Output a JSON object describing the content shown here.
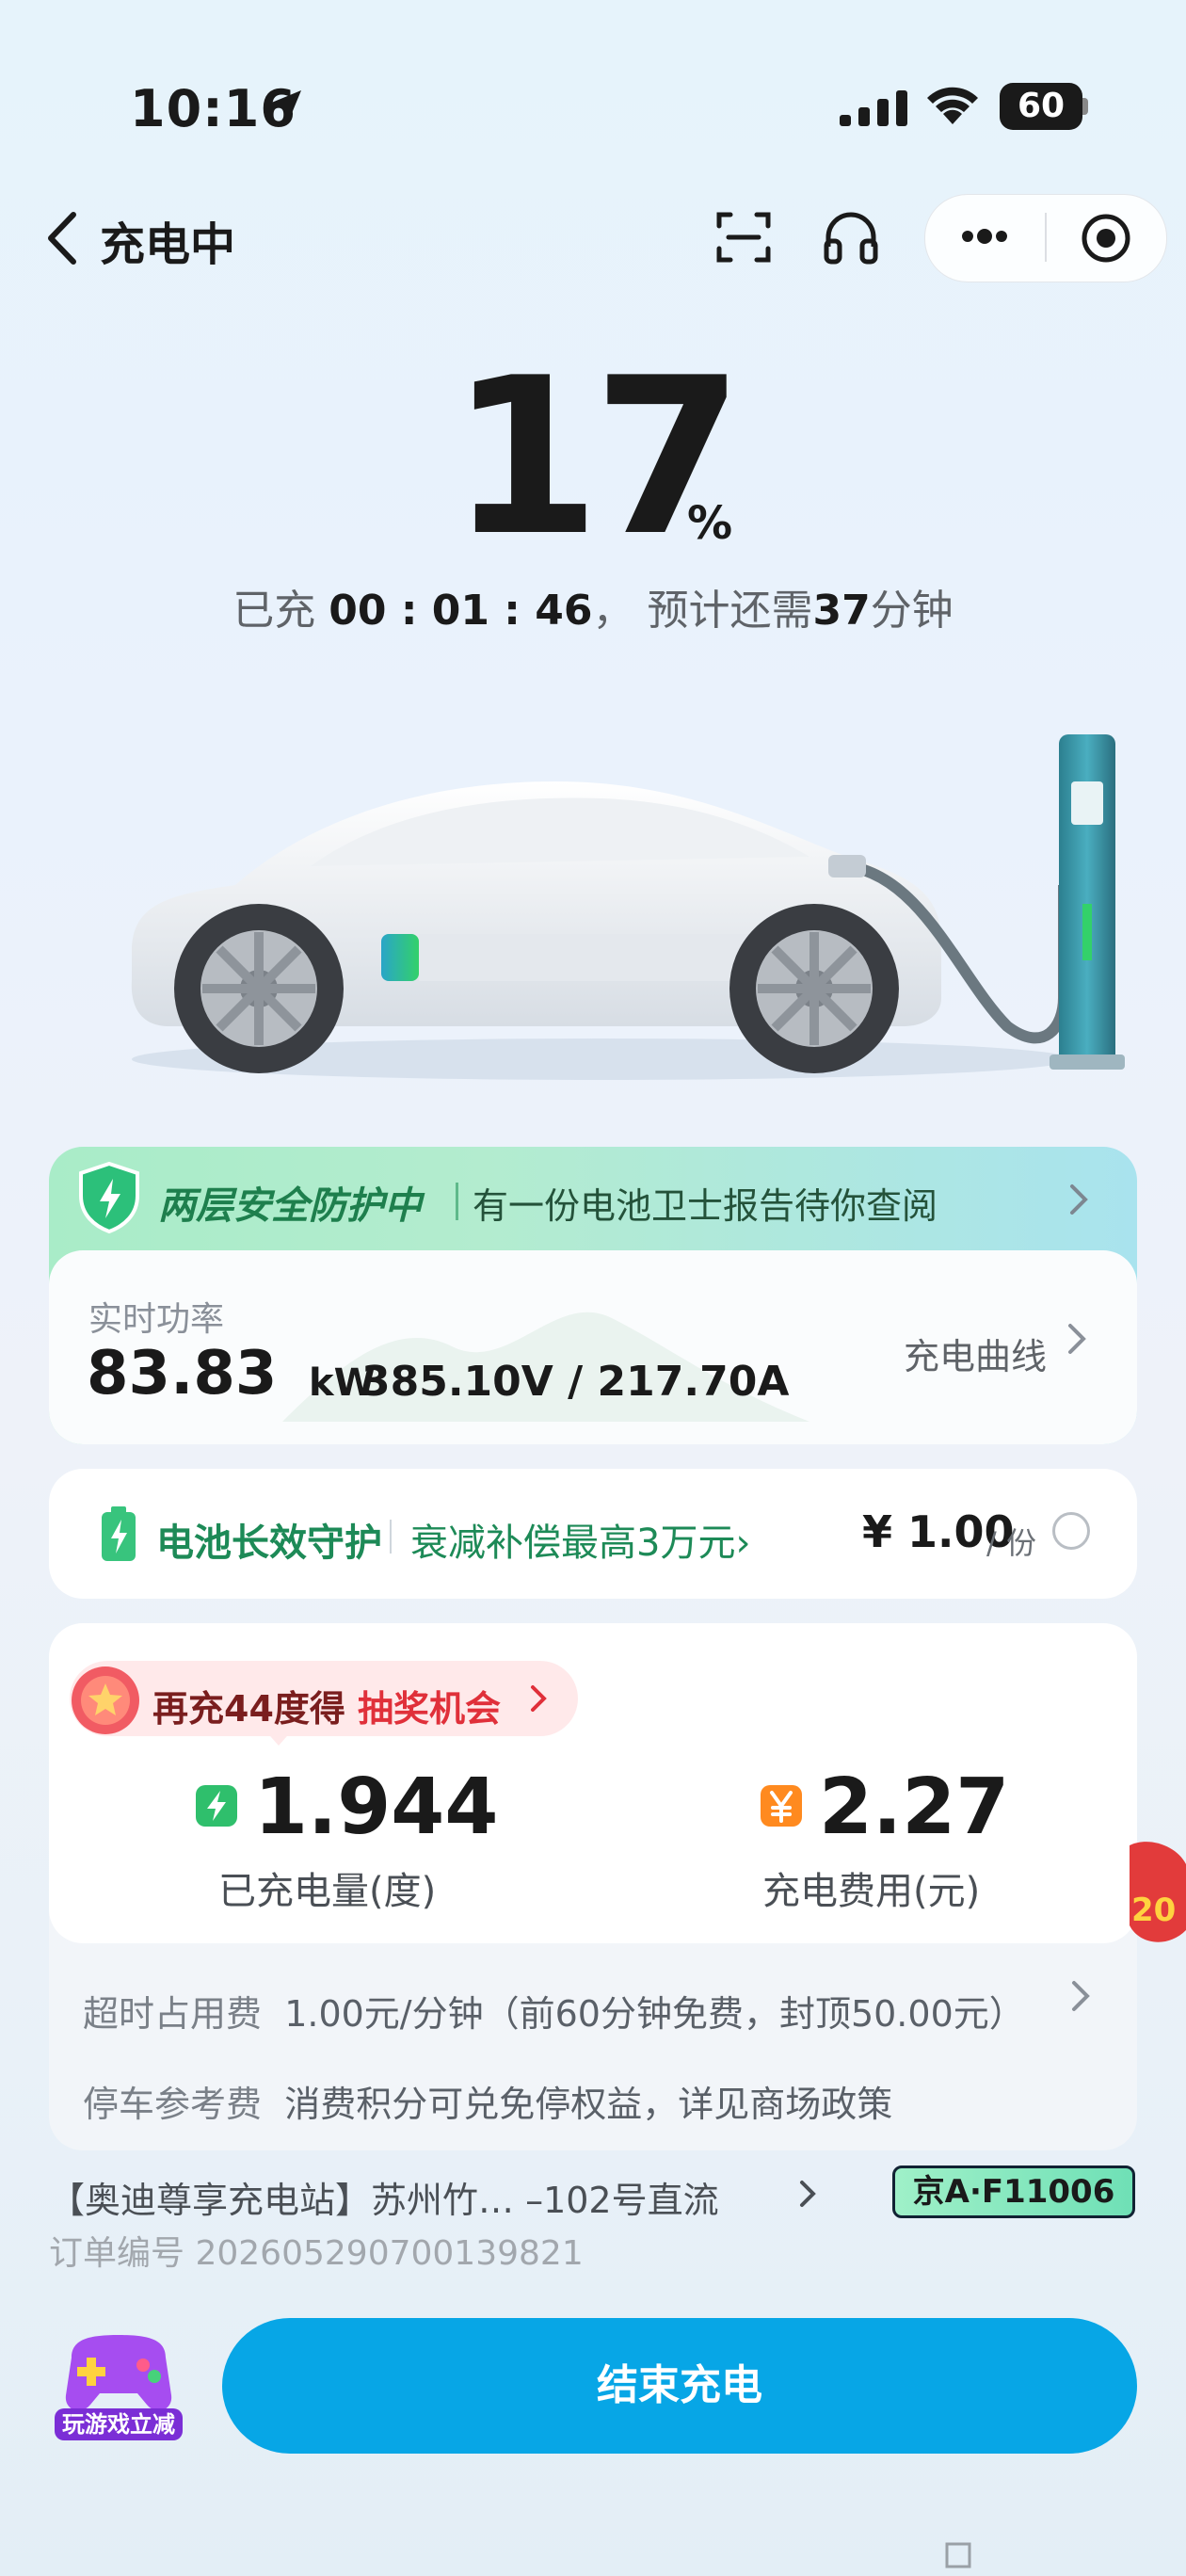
{
  "status_bar": {
    "time": "10:16",
    "battery": "60"
  },
  "nav": {
    "title": "充电中"
  },
  "charge": {
    "percent": "17",
    "percent_sign": "%",
    "elapsed_prefix": "已充 ",
    "elapsed_time": "00 : 01 : 46",
    "elapsed_mid": "， 预计还需",
    "remaining": "37",
    "remaining_unit": "分钟"
  },
  "safety": {
    "title": "两层安全防护中",
    "subtitle": "有一份电池卫士报告待你查阅"
  },
  "power": {
    "label": "实时功率",
    "value": "83.83",
    "unit": "kW",
    "voltage_current": "385.10V / 217.70A",
    "curve_link": "充电曲线"
  },
  "battery_guard": {
    "title": "电池长效守护",
    "subtitle": "衰减补偿最高3万元",
    "chevron": "›",
    "price": "¥ 1.00",
    "unit": "/ 份",
    "selected": false
  },
  "promo": {
    "text1": "再充44度得 ",
    "text2": "抽奖机会"
  },
  "stats": {
    "energy_value": "1.944",
    "energy_label": "已充电量(度)",
    "fee_value": "2.27",
    "fee_label": "充电费用(元)"
  },
  "fees": {
    "overtime_label": "超时占用费",
    "overtime_value": "1.00元/分钟（前60分钟免费，封顶50.00元）",
    "parking_label": "停车参考费",
    "parking_value": "消费积分可兑免停权益，详见商场政策"
  },
  "station": {
    "name": "【奥迪尊享充电站】苏州竹… –102号直流",
    "plate": "京A·F11006"
  },
  "order": {
    "label": "订单编号 ",
    "number": "20260529070013982​1"
  },
  "game": {
    "label": "玩游戏立减"
  },
  "floater": {
    "label": "20"
  },
  "end_button": {
    "label": "结束充电"
  },
  "colors": {
    "accent": "#07a6e6",
    "green": "#1d8a57",
    "red": "#e0303a"
  }
}
